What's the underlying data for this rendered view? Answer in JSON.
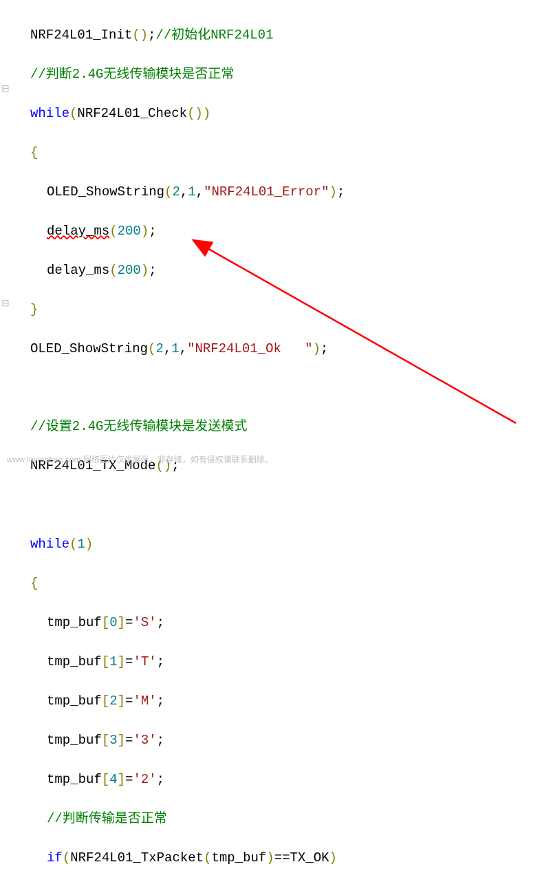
{
  "code": {
    "line1_func": "NRF24L01_Init",
    "line1_comment": "//初始化NRF24L01",
    "line2_comment": "//判断2.4G无线传输模块是否正常",
    "line3_kw": "while",
    "line3_func": "NRF24L01_Check",
    "line5_func": "OLED_ShowString",
    "line5_n1": "2",
    "line5_n2": "1",
    "line5_str": "\"NRF24L01_Error\"",
    "line6_func": "delay_ms",
    "line6_n": "200",
    "line7_func": "delay_ms",
    "line7_n": "200",
    "line9_func": "OLED_ShowString",
    "line9_n1": "2",
    "line9_n2": "1",
    "line9_str": "\"NRF24L01_Ok   \"",
    "line11_comment": "//设置2.4G无线传输模块是发送模式",
    "line12_func": "NRF24L01_TX_Mode",
    "line14_kw": "while",
    "line14_n": "1",
    "line16_arr": "tmp_buf",
    "line16_idx": "0",
    "line16_ch": "'S'",
    "line17_arr": "tmp_buf",
    "line17_idx": "1",
    "line17_ch": "'T'",
    "line18_arr": "tmp_buf",
    "line18_idx": "2",
    "line18_ch": "'M'",
    "line19_arr": "tmp_buf",
    "line19_idx": "3",
    "line19_ch": "'3'",
    "line20_arr": "tmp_buf",
    "line20_idx": "4",
    "line20_ch": "'2'",
    "line21_comment": "//判断传输是否正常",
    "line22_kw": "if",
    "line22_func": "NRF24L01_TxPacket",
    "line22_arg": "tmp_buf",
    "line22_cmp": "TX_OK"
  },
  "watermark": "www.toymoban.com 网络图片仅供展示，非存储，如有侵权请联系删除。"
}
